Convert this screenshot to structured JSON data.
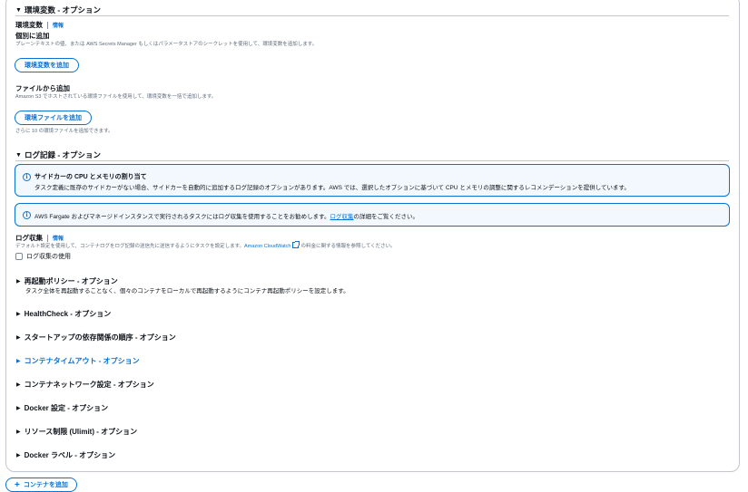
{
  "env_section": {
    "title": "環境変数 - オプション",
    "label": "環境変数",
    "info": "情報",
    "individual": {
      "label": "個別に追加",
      "desc": "プレーンテキストの値、または AWS Secrets Manager もしくはパラメータストアのシークレットを使用して、環境変数を追加します。",
      "button": "環境変数を追加"
    },
    "file": {
      "label": "ファイルから追加",
      "desc": "Amazon S3 でホストされている環境ファイルを使用して、環境変数を一括で追加します。",
      "button": "環境ファイルを追加",
      "note": "さらに 10 の環境ファイルを追加できます。"
    }
  },
  "log_section": {
    "title": "ログ記録 - オプション",
    "alert1": {
      "title": "サイドカーの CPU とメモリの割り当て",
      "text": "タスク定義に既存のサイドカーがない場合、サイドカーを自動的に追加するログ記録のオプションがあります。AWS では、選択したオプションに基づいて CPU とメモリの調整に関するレコメンデーションを提供しています。"
    },
    "alert2": {
      "text_before": "AWS Fargate およびマネージドインスタンスで実行されるタスクにはログ収集を使用することをお勧めします。",
      "link": "ログ収集",
      "text_after": "の詳細をご覧ください。"
    },
    "collection": {
      "label": "ログ収集",
      "info": "情報",
      "desc_before": "デフォルト設定を使用して、コンテナログをログ記録の送信先に送信するようにタスクを設定します。",
      "desc_link": "Amazon CloudWatch",
      "desc_after": "の料金に関する情報を参照してください。",
      "checkbox": "ログ収集の使用",
      "checked": false
    }
  },
  "restart": {
    "title": "再起動ポリシー - オプション",
    "desc": "タスク全体を再起動することなく、個々のコンテナをローカルで再起動するようにコンテナ再起動ポリシーを設定します。"
  },
  "expanders": {
    "healthcheck": "HealthCheck - オプション",
    "startup": "スタートアップの依存関係の順序 - オプション",
    "timeout": "コンテナタイムアウト - オプション",
    "network": "コンテナネットワーク設定 - オプション",
    "docker": "Docker 設定 - オプション",
    "ulimit": "リソース制限 (Ulimit) - オプション",
    "labels": "Docker ラベル - オプション"
  },
  "add_container": "コンテナを追加",
  "colors": {
    "accent": "#0972d3",
    "alert_bg": "#f2f8fd",
    "border": "#c6c6cd"
  }
}
